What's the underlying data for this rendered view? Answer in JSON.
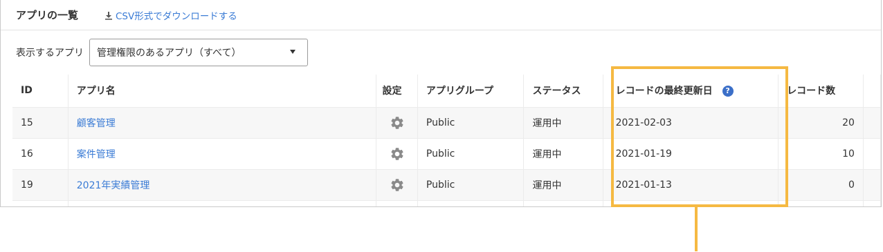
{
  "header": {
    "title": "アプリの一覧",
    "csv_link": "CSV形式でダウンロードする"
  },
  "filter": {
    "label": "表示するアプリ",
    "selected": "管理権限のあるアプリ（すべて）"
  },
  "table": {
    "columns": [
      "ID",
      "アプリ名",
      "設定",
      "アプリグループ",
      "ステータス",
      "レコードの最終更新日",
      "レコード数"
    ],
    "rows": [
      {
        "id": "15",
        "name": "顧客管理",
        "group": "Public",
        "status": "運用中",
        "updated": "2021-02-03",
        "count": "20"
      },
      {
        "id": "16",
        "name": "案件管理",
        "group": "Public",
        "status": "運用中",
        "updated": "2021-01-19",
        "count": "10"
      },
      {
        "id": "19",
        "name": "2021年実績管理",
        "group": "Public",
        "status": "運用中",
        "updated": "2021-01-13",
        "count": "0"
      }
    ]
  },
  "help_icon": "?",
  "colors": {
    "link": "#3a7bd5",
    "highlight": "#f5b942",
    "help_icon": "#3b6fc8"
  }
}
